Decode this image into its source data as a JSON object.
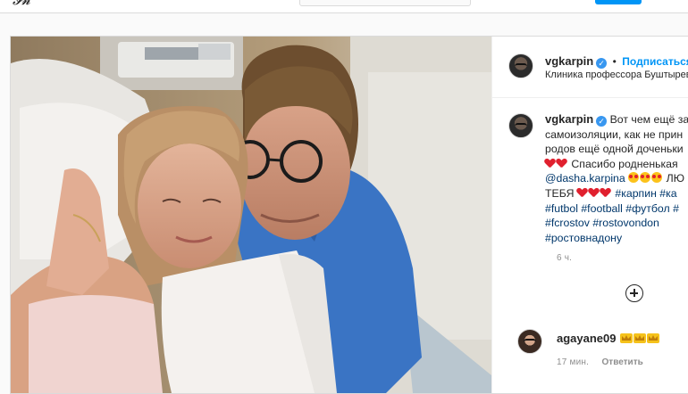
{
  "colors": {
    "link_blue": "#0095f6",
    "hashtag": "#00376b",
    "verified": "#3897f0",
    "heart": "#e0202e",
    "muted": "#8e8e8e"
  },
  "post": {
    "photo_icon": "selfie-photo",
    "author": {
      "username": "vgkarpin",
      "follow_label": "Подписаться",
      "separator": "•",
      "location": "Клиника профессора Буштырево"
    },
    "caption": {
      "username": "vgkarpin",
      "line1": "Вот чем ещё зан",
      "line2": "самоизоляции, как не прин",
      "line3": "родов ещё одной доченьки",
      "line4_text": "Спасибо родненькая",
      "line5_mention": "@dasha.karpina",
      "line5_tail": "ЛЮ",
      "line6_text": "ТЕБЯ",
      "line6_tag1": "#карпин",
      "line6_tag2": "#ка",
      "line7_tag1": "#futbol",
      "line7_tag2": "#football",
      "line7_tag3": "#футбол",
      "line7_tag4": "#",
      "line8_tag1": "#fcrostov",
      "line8_tag2": "#rostovondon",
      "line9_tag1": "#ростовнадону",
      "time": "6 ч."
    },
    "comment": {
      "username": "agayane09",
      "time": "17 мин.",
      "reply_label": "Ответить"
    }
  }
}
